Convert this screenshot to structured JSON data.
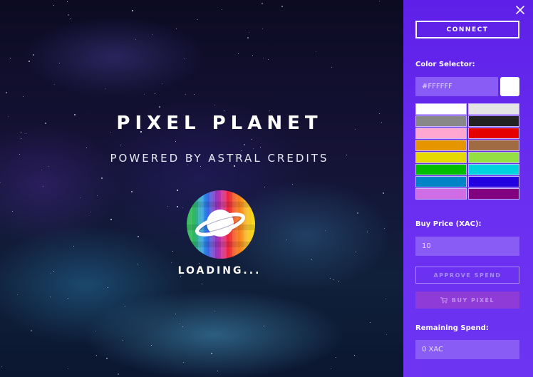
{
  "hero": {
    "title": "PIXEL PLANET",
    "subtitle": "POWERED BY ASTRAL CREDITS",
    "loading": "LOADING..."
  },
  "panel": {
    "close_icon": "close-icon",
    "connect_label": "CONNECT",
    "color_selector_label": "Color Selector:",
    "hex_value": "#FFFFFF",
    "selected_color": "#FFFFFF",
    "palette": [
      "#FFFFFF",
      "#E4E4E4",
      "#888888",
      "#222222",
      "#FFA7D1",
      "#E50000",
      "#E59500",
      "#A06A42",
      "#E5D900",
      "#94E044",
      "#02BE01",
      "#00D3DD",
      "#0083C7",
      "#2200E0",
      "#CF6EE4",
      "#820080"
    ],
    "buy_price_label": "Buy Price (XAC):",
    "buy_price_value": "10",
    "approve_label": "APPROVE SPEND",
    "buy_label": "BUY PIXEL",
    "buy_icon": "cart-icon",
    "remaining_label": "Remaining Spend:",
    "remaining_value": "0 XAC"
  }
}
